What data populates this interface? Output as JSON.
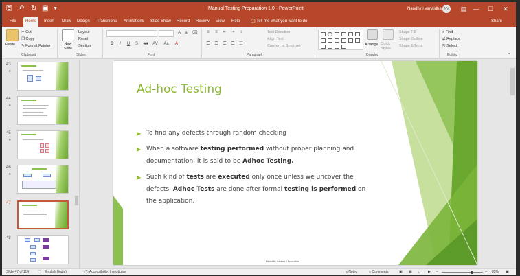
{
  "titlebar": {
    "title": "Manual Testing Preparation 1.0  -  PowerPoint",
    "user": "Nandhini vanaidhan",
    "avatar_initials": "NV",
    "icons": [
      "save-icon",
      "undo-icon",
      "redo-icon",
      "present-icon",
      "customize-icon"
    ],
    "window_buttons": [
      "—",
      "☐",
      "✕"
    ]
  },
  "tabs": [
    "File",
    "Home",
    "Insert",
    "Draw",
    "Design",
    "Transitions",
    "Animations",
    "Slide Show",
    "Record",
    "Review",
    "View",
    "Help"
  ],
  "active_tab": "Home",
  "tell_me": "Tell me what you want to do",
  "share": "Share",
  "ribbon": {
    "clipboard": {
      "paste": "Paste",
      "cut": "Cut",
      "copy": "Copy",
      "format_painter": "Format Painter",
      "label": "Clipboard"
    },
    "slides": {
      "new_slide": "New Slide",
      "layout": "Layout",
      "reset": "Reset",
      "section": "Section",
      "label": "Slides"
    },
    "font": {
      "label": "Font",
      "format_buttons": [
        "B",
        "I",
        "U",
        "S",
        "ab",
        "AV",
        "Aa",
        "A"
      ]
    },
    "paragraph": {
      "text_direction": "Text Direction",
      "align_text": "Align Text",
      "convert_smartart": "Convert to SmartArt",
      "label": "Paragraph"
    },
    "drawing": {
      "arrange": "Arrange",
      "quick_styles": "Quick Styles",
      "shape_fill": "Shape Fill",
      "shape_outline": "Shape Outline",
      "shape_effects": "Shape Effects",
      "label": "Drawing"
    },
    "editing": {
      "find": "Find",
      "replace": "Replace",
      "select": "Select",
      "label": "Editing"
    }
  },
  "thumbnails": [
    {
      "num": "43",
      "title": "Ad-hoc Testing"
    },
    {
      "num": "44",
      "title": "Monkey Testing"
    },
    {
      "num": "45",
      "title": "Gorilla Testing"
    },
    {
      "num": "46",
      "title": "Sanity Testing"
    },
    {
      "num": "47",
      "title": "Ad-hoc Testing",
      "selected": true
    },
    {
      "num": "48",
      "title": ""
    }
  ],
  "slide": {
    "title": "Ad-hoc Testing",
    "bullets": [
      [
        {
          "t": "To find any defects through random checking",
          "b": false
        }
      ],
      [
        {
          "t": "When a software ",
          "b": false
        },
        {
          "t": "testing performed",
          "b": true
        },
        {
          "t": " without proper planning and documentation, it is said to be ",
          "b": false
        },
        {
          "t": "Adhoc Testing.",
          "b": true
        }
      ],
      [
        {
          "t": "Such kind of ",
          "b": false
        },
        {
          "t": "tests",
          "b": true
        },
        {
          "t": " are ",
          "b": false
        },
        {
          "t": "executed",
          "b": true
        },
        {
          "t": " only once unless we uncover the defects. ",
          "b": false
        },
        {
          "t": "Adhoc Tests",
          "b": true
        },
        {
          "t": " are done after formal ",
          "b": false
        },
        {
          "t": "testing is performed",
          "b": true
        },
        {
          "t": " on the application.",
          "b": false
        }
      ]
    ],
    "footer": "Flexibility, Interest & Productive"
  },
  "status": {
    "slide_count": "Slide 47 of 114",
    "language": "English (India)",
    "accessibility": "Accessibility: Investigate",
    "notes": "Notes",
    "comments": "Comments",
    "zoom": "85%"
  },
  "colors": {
    "accent": "#b7472a",
    "slide_green": "#8cb832"
  }
}
